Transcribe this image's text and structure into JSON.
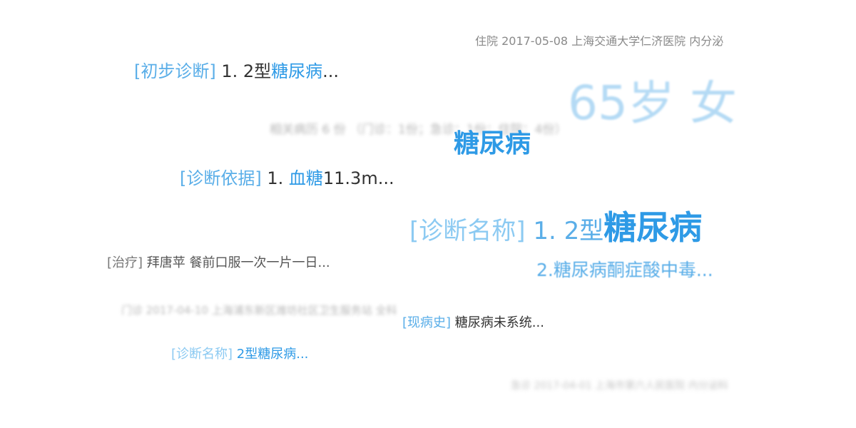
{
  "header_record": "住院 2017-05-08 上海交通大学仁济医院 内分泌",
  "age_gender": "65岁 女",
  "related_records": "相关病历 6 份 （门诊：1份；急诊：1份；住院：4份）",
  "center_term": "糖尿病",
  "preliminary_diagnosis": {
    "tag": "[初步诊断]",
    "prefix": " 1. 2型",
    "highlight": "糖尿病",
    "suffix": "..."
  },
  "diagnosis_basis": {
    "tag": "[诊断依据]",
    "prefix": " 1. ",
    "highlight": "血糖",
    "suffix": "11.3m..."
  },
  "diagnosis_name_main": {
    "tag": "[诊断名称]",
    "prefix": " 1. 2型",
    "highlight": "糖尿病",
    "line2": "2.糖尿病酮症酸中毒..."
  },
  "treatment": {
    "tag": "[治疗]",
    "text": " 拜唐苹 餐前口服一次一片一日..."
  },
  "clinic_record": "门诊 2017-04-10 上海浦东新区潍坊社区卫生服务站 全科",
  "present_illness": {
    "tag": "[现病史]",
    "text": " 糖尿病未系统..."
  },
  "diagnosis_name_small": {
    "tag": "[诊断名称]",
    "highlight": " 2型糖尿病..."
  },
  "footer_record": "急诊 2017-04-01 上海市第六人民医院 内分泌科"
}
